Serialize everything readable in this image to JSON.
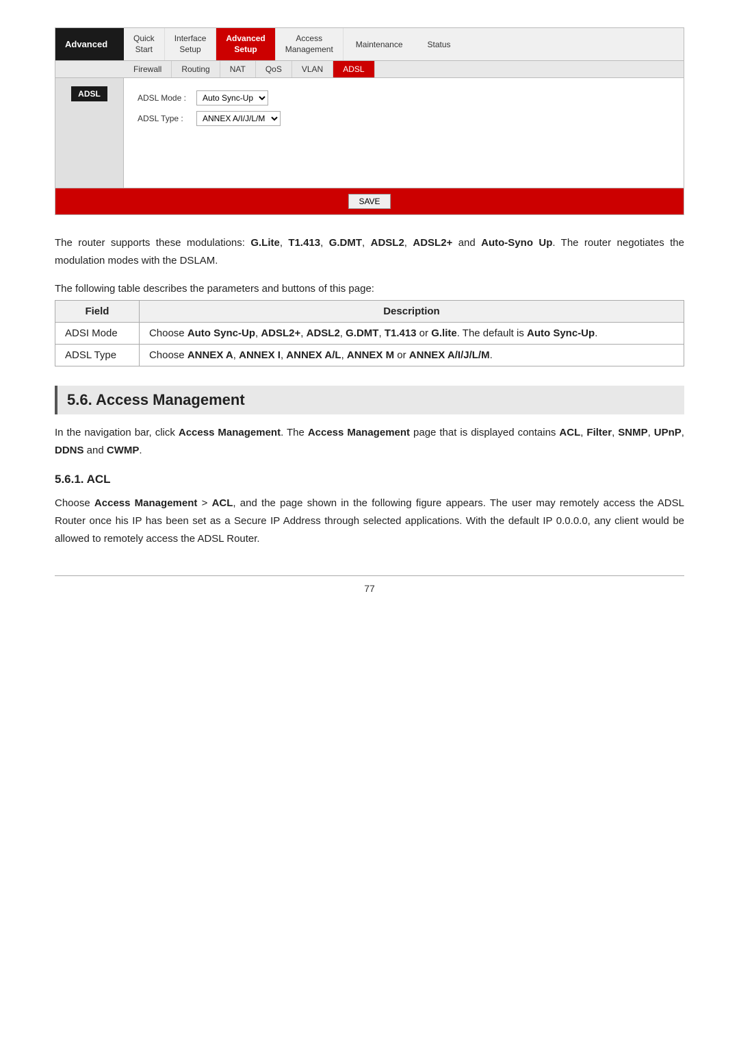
{
  "router_ui": {
    "nav": {
      "advanced_label": "Advanced",
      "items": [
        {
          "label": "Quick\nStart",
          "active": false
        },
        {
          "label": "Interface\nSetup",
          "active": false
        },
        {
          "label": "Advanced\nSetup",
          "active": true
        },
        {
          "label": "Access\nManagement",
          "active": false
        },
        {
          "label": "Maintenance",
          "active": false
        },
        {
          "label": "Status",
          "active": false
        }
      ],
      "sub_items": [
        {
          "label": "Firewall",
          "active": false
        },
        {
          "label": "Routing",
          "active": false
        },
        {
          "label": "NAT",
          "active": false
        },
        {
          "label": "QoS",
          "active": false
        },
        {
          "label": "VLAN",
          "active": false
        },
        {
          "label": "ADSL",
          "active": true
        }
      ]
    },
    "sidebar_label": "ADSL",
    "form": {
      "adsl_mode_label": "ADSL Mode :",
      "adsl_mode_value": "Auto Sync-Up",
      "adsl_type_label": "ADSL Type :",
      "adsl_type_value": "ANNEX A/I/J/L/M"
    },
    "save_button": "SAVE"
  },
  "main_text": "The router supports these modulations: G.Lite, T1.413, G.DMT, ADSL2, ADSL2+ and Auto-Syno Up. The router negotiates the modulation modes with the DSLAM.",
  "table_intro": "The following table describes the parameters and buttons of this page:",
  "table": {
    "col_field": "Field",
    "col_description": "Description",
    "rows": [
      {
        "field": "ADSI Mode",
        "description_parts": [
          {
            "text": "Choose ",
            "bold": false
          },
          {
            "text": "Auto Sync-Up",
            "bold": true
          },
          {
            "text": ", ",
            "bold": false
          },
          {
            "text": "ADSL2+",
            "bold": true
          },
          {
            "text": ", ",
            "bold": false
          },
          {
            "text": "ADSL2",
            "bold": true
          },
          {
            "text": ", ",
            "bold": false
          },
          {
            "text": "G.DMT",
            "bold": true
          },
          {
            "text": ", ",
            "bold": false
          },
          {
            "text": "T1.413",
            "bold": true
          },
          {
            "text": " or\n",
            "bold": false
          },
          {
            "text": "G.lite",
            "bold": true
          },
          {
            "text": ". The default is ",
            "bold": false
          },
          {
            "text": "Auto Sync-Up",
            "bold": true
          },
          {
            "text": ".",
            "bold": false
          }
        ],
        "description_raw": "Choose Auto Sync-Up, ADSL2+, ADSL2, G.DMT, T1.413 or G.lite. The default is Auto Sync-Up."
      },
      {
        "field": "ADSL Type",
        "description_raw": "Choose ANNEX A, ANNEX I, ANNEX A/L, ANNEX M or ANNEX A/I/J/L/M.",
        "description_parts": [
          {
            "text": "Choose ",
            "bold": false
          },
          {
            "text": "ANNEX A",
            "bold": true
          },
          {
            "text": ", ",
            "bold": false
          },
          {
            "text": "ANNEX I",
            "bold": true
          },
          {
            "text": ", ",
            "bold": false
          },
          {
            "text": "ANNEX A/L",
            "bold": true
          },
          {
            "text": ", ",
            "bold": false
          },
          {
            "text": "ANNEX M",
            "bold": true
          },
          {
            "text": " or\n",
            "bold": false
          },
          {
            "text": "ANNEX A/I/J/L/M",
            "bold": true
          },
          {
            "text": ".",
            "bold": false
          }
        ]
      }
    ]
  },
  "section56": {
    "heading": "5.6. Access Management",
    "para1_prefix": "In the navigation bar, click ",
    "para1_bold1": "Access Management",
    "para1_mid": ". The ",
    "para1_bold2": "Access Management",
    "para1_suffix": " page that is displayed contains ",
    "para1_items": "ACL, Filter, SNMP, UPnP, DDNS and CWMP.",
    "items_bold": [
      "ACL",
      "Filter",
      "SNMP",
      "UPnP",
      "DDNS",
      "CWMP"
    ]
  },
  "section561": {
    "heading": "5.6.1.     ACL",
    "para": "Choose Access Management > ACL, and the page shown in the following figure appears. The user may remotely access the ADSL Router once his IP has been set as a Secure IP Address through selected applications. With the default IP 0.0.0.0, any client would be allowed to remotely access the ADSL Router."
  },
  "footer": {
    "page_number": "77"
  }
}
